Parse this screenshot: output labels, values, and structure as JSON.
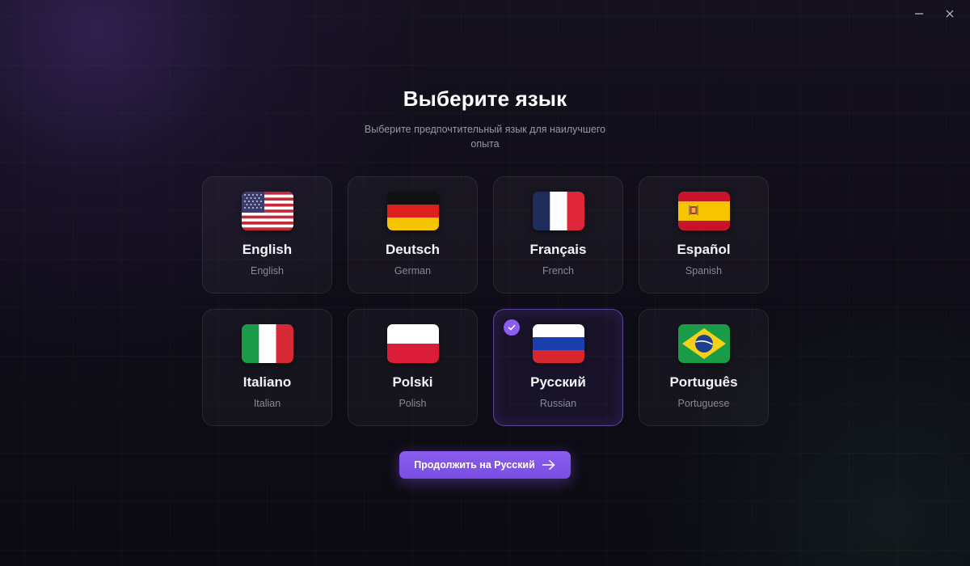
{
  "window": {
    "controls": [
      {
        "name": "minimize",
        "icon": "minimize-icon"
      },
      {
        "name": "close",
        "icon": "close-icon"
      }
    ]
  },
  "header": {
    "title": "Выберите язык",
    "subtitle": "Выберите предпочтительный язык для наилучшего опыта"
  },
  "languages": [
    {
      "name": "English",
      "sub": "English",
      "flag": "us-flag-icon",
      "selected": false
    },
    {
      "name": "Deutsch",
      "sub": "German",
      "flag": "germany-flag-icon",
      "selected": false
    },
    {
      "name": "Français",
      "sub": "French",
      "flag": "france-flag-icon",
      "selected": false
    },
    {
      "name": "Español",
      "sub": "Spanish",
      "flag": "spain-flag-icon",
      "selected": false
    },
    {
      "name": "Italiano",
      "sub": "Italian",
      "flag": "italy-flag-icon",
      "selected": false
    },
    {
      "name": "Polski",
      "sub": "Polish",
      "flag": "poland-flag-icon",
      "selected": false
    },
    {
      "name": "Русский",
      "sub": "Russian",
      "flag": "russia-flag-icon",
      "selected": true
    },
    {
      "name": "Português",
      "sub": "Portuguese",
      "flag": "brazil-flag-icon",
      "selected": false
    }
  ],
  "continue_button": {
    "label": "Продолжить на Русский",
    "icon": "arrow-right-icon"
  },
  "colors": {
    "accent": "#8a5cf0",
    "background": "#0d0b14",
    "card_border": "#2a2833",
    "muted_text": "#8a8898"
  }
}
